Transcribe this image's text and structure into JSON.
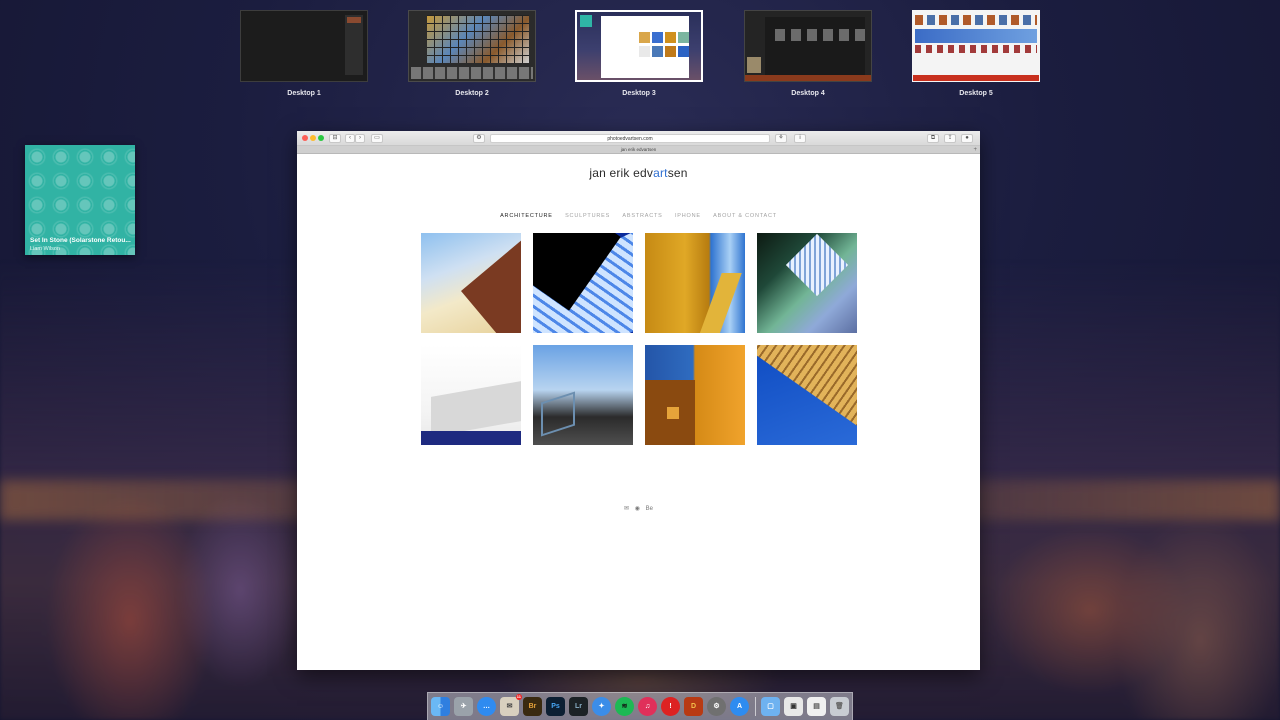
{
  "spaces": [
    {
      "label": "Desktop 1"
    },
    {
      "label": "Desktop 2"
    },
    {
      "label": "Desktop 3"
    },
    {
      "label": "Desktop 4"
    },
    {
      "label": "Desktop 5"
    }
  ],
  "now_playing": {
    "title": "Set In Stone (Solarstone Retou...",
    "artist": "Liam Wilson"
  },
  "browser": {
    "address": "photoedvartsen.com",
    "tab_title": "jan erik edvartsen",
    "tab_plus": "+"
  },
  "site": {
    "title_pre": "jan erik edv",
    "title_accent": "art",
    "title_post": "sen",
    "nav": [
      "ARCHITECTURE",
      "SCULPTURES",
      "ABSTRACTS",
      "IPHONE",
      "ABOUT & CONTACT"
    ],
    "active_nav": "ARCHITECTURE",
    "footer": {
      "email_icon": "✉",
      "flickr_icon": "◉",
      "behance_icon": "Be"
    }
  },
  "dock": {
    "items": [
      "Finder",
      "Launchpad",
      "Messages",
      "Mail",
      "Br",
      "Ps",
      "Lr",
      "Safari",
      "Spotify",
      "iTunes",
      "Reminders",
      "DOOM",
      "System Preferences",
      "App Store",
      "Downloads",
      "Preview",
      "Mail Viewer",
      "Trash"
    ],
    "mail_badge": "11"
  },
  "colors": {
    "accent": "#2f6fd1",
    "tile": "#31b3a4"
  }
}
